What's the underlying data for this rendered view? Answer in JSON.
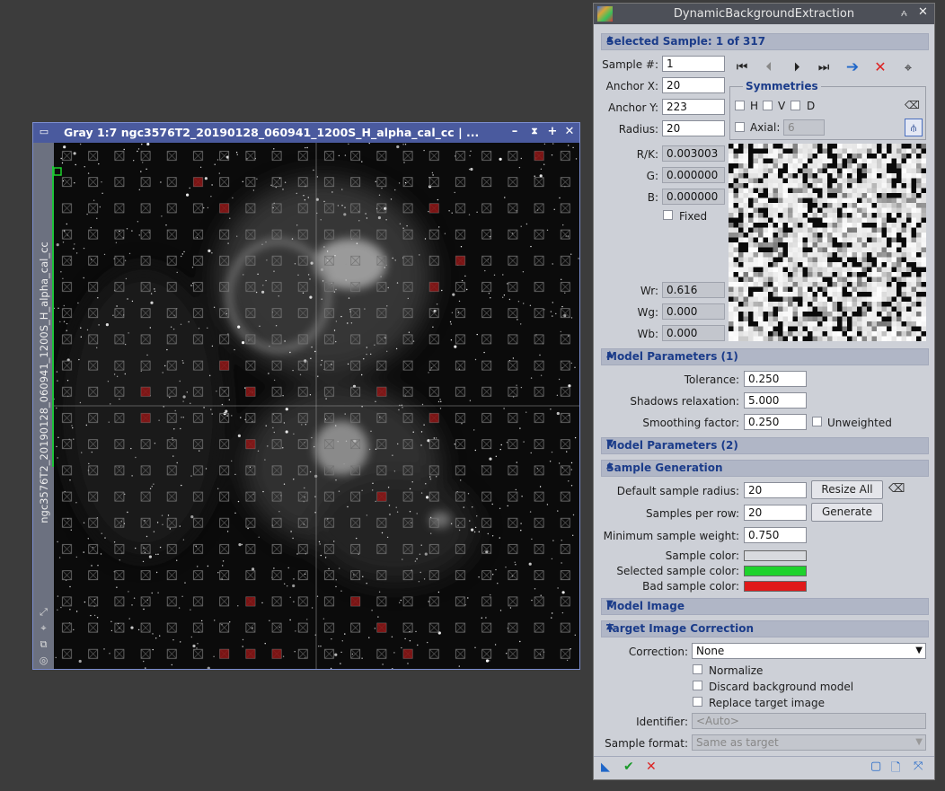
{
  "image_window": {
    "title": "Gray 1:7 ngc3576T2_20190128_060941_1200S_H_alpha_cal_cc | ...",
    "side_label": "ngc3576T2_20190128_060941_1200S_H_alpha_cal_cc",
    "icons": [
      "window-icon",
      "minimize-icon",
      "shade-icon",
      "maximize-icon",
      "close-icon"
    ],
    "tool_icons": [
      "fit-icon",
      "zoom-icon",
      "clone-icon",
      "target-icon"
    ]
  },
  "dbe": {
    "title": "DynamicBackgroundExtraction",
    "selected_sample": {
      "header": "Selected Sample: 1 of 317",
      "sample_label": "Sample #:",
      "sample_value": "1",
      "anchor_x_label": "Anchor X:",
      "anchor_x_value": "20",
      "anchor_y_label": "Anchor Y:",
      "anchor_y_value": "223",
      "radius_label": "Radius:",
      "radius_value": "20",
      "symmetries_label": "Symmetries",
      "h_label": "H",
      "v_label": "V",
      "d_label": "D",
      "axial_label": "Axial:",
      "axial_value": "6",
      "rk_label": "R/K:",
      "rk_value": "0.003003",
      "g_label": "G:",
      "g_value": "0.000000",
      "b_label": "B:",
      "b_value": "0.000000",
      "fixed_label": "Fixed",
      "wr_label": "Wr:",
      "wr_value": "0.616",
      "wg_label": "Wg:",
      "wg_value": "0.000",
      "wb_label": "Wb:",
      "wb_value": "0.000"
    },
    "model_params_1": {
      "header": "Model Parameters (1)",
      "tolerance_label": "Tolerance:",
      "tolerance_value": "0.250",
      "shadows_label": "Shadows relaxation:",
      "shadows_value": "5.000",
      "smoothing_label": "Smoothing factor:",
      "smoothing_value": "0.250",
      "unweighted_label": "Unweighted"
    },
    "model_params_2": {
      "header": "Model Parameters (2)"
    },
    "sample_generation": {
      "header": "Sample Generation",
      "default_radius_label": "Default sample radius:",
      "default_radius_value": "20",
      "resize_all_label": "Resize All",
      "samples_per_row_label": "Samples per row:",
      "samples_per_row_value": "20",
      "generate_label": "Generate",
      "min_weight_label": "Minimum sample weight:",
      "min_weight_value": "0.750",
      "sample_color_label": "Sample color:",
      "selected_color_label": "Selected sample color:",
      "bad_color_label": "Bad sample color:",
      "sample_color": "#d8dade",
      "selected_color": "#1ed22c",
      "bad_color": "#e01919"
    },
    "model_image": {
      "header": "Model Image"
    },
    "target_correction": {
      "header": "Target Image Correction",
      "correction_label": "Correction:",
      "correction_value": "None",
      "normalize_label": "Normalize",
      "discard_label": "Discard background model",
      "replace_label": "Replace target image",
      "identifier_label": "Identifier:",
      "identifier_placeholder": "<Auto>",
      "format_label": "Sample format:",
      "format_value": "Same as target"
    }
  }
}
